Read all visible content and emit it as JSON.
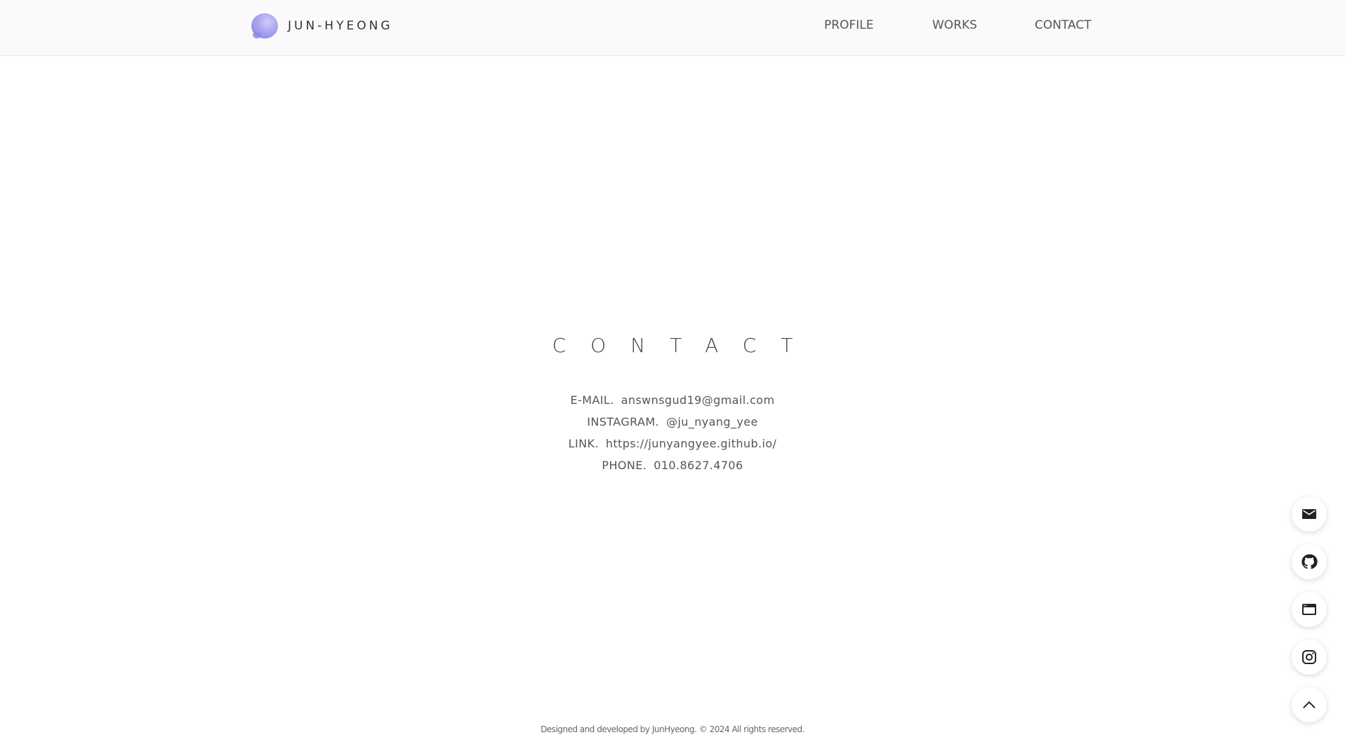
{
  "header": {
    "logo_text": "JUN-HYEONG",
    "nav": [
      {
        "label": "PROFILE"
      },
      {
        "label": "WORKS"
      },
      {
        "label": "CONTACT"
      }
    ]
  },
  "contact": {
    "title": "CONTACT",
    "rows": [
      {
        "label": "E-MAIL.",
        "value": "answnsgud19@gmail.com"
      },
      {
        "label": "INSTAGRAM.",
        "value": "@ju_nyang_yee"
      },
      {
        "label": "LINK.",
        "value": "https://junyangyee.github.io/"
      },
      {
        "label": "PHONE.",
        "value": "010.8627.4706"
      }
    ]
  },
  "footer": {
    "text": "Designed and developed by JunHyeong. © 2024 All rights reserved."
  },
  "floating_buttons": [
    {
      "icon": "mail-icon"
    },
    {
      "icon": "github-icon"
    },
    {
      "icon": "browser-card-icon"
    },
    {
      "icon": "instagram-icon"
    },
    {
      "icon": "chevron-up-icon"
    }
  ],
  "colors": {
    "header_bg": "#fafafc",
    "text": "#555555",
    "logo_gradient_light": "#d2cdf8",
    "logo_gradient_dark": "#7f83e6"
  }
}
